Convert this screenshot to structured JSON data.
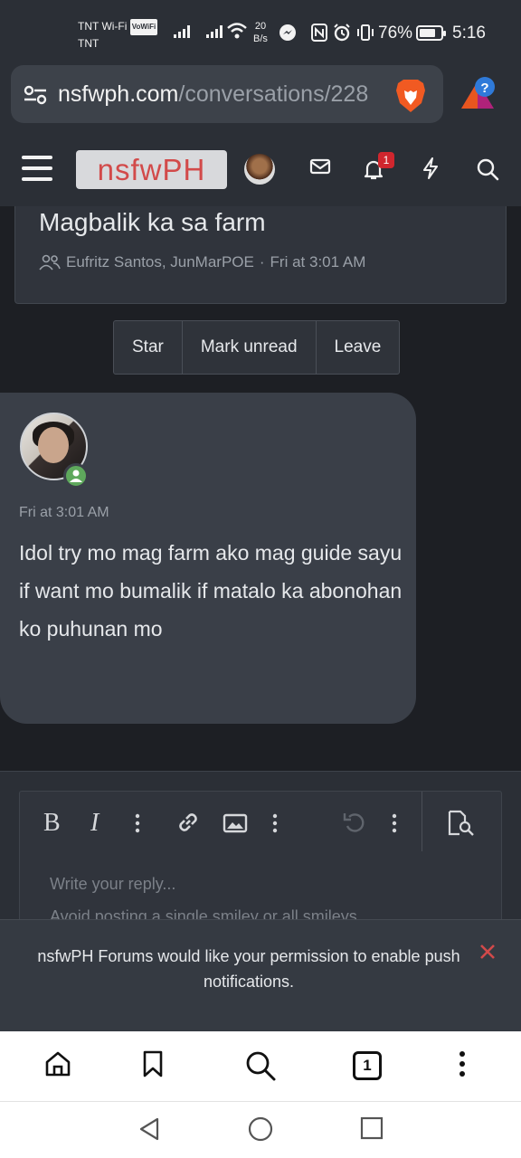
{
  "status_bar": {
    "carrier_line1": "TNT Wi-Fi",
    "volte_badge": "VoWiFi",
    "carrier_line2": "TNT",
    "net_speed_value": "20",
    "net_speed_unit": "B/s",
    "battery_percent": "76%",
    "battery_level": 0.76,
    "time": "5:16"
  },
  "browser": {
    "url_host": "nsfwph.com",
    "url_path": "/conversations/228",
    "tab_count": "1"
  },
  "forum_header": {
    "logo_text": "nsfwPH",
    "alert_count": "1"
  },
  "conversation": {
    "title": "Magbalik ka sa farm",
    "participants": "Eufritz Santos, JunMarPOE",
    "separator": "·",
    "date": "Fri at 3:01 AM",
    "actions": [
      "Star",
      "Mark unread",
      "Leave"
    ]
  },
  "message": {
    "time": "Fri at 3:01 AM",
    "text": "Idol try mo mag farm ako mag guide sayu if want mo bumalik if matalo ka abonohan ko puhunan mo"
  },
  "editor": {
    "placeholder": "Write your reply...",
    "hint": "Avoid posting a single smiley or all smileys"
  },
  "push_notice": {
    "text": "nsfwPH Forums would like your permission to enable push notifications."
  },
  "colors": {
    "accent_red": "#d24a4a",
    "online_green": "#5ea85c",
    "background": "#1d1f24"
  }
}
